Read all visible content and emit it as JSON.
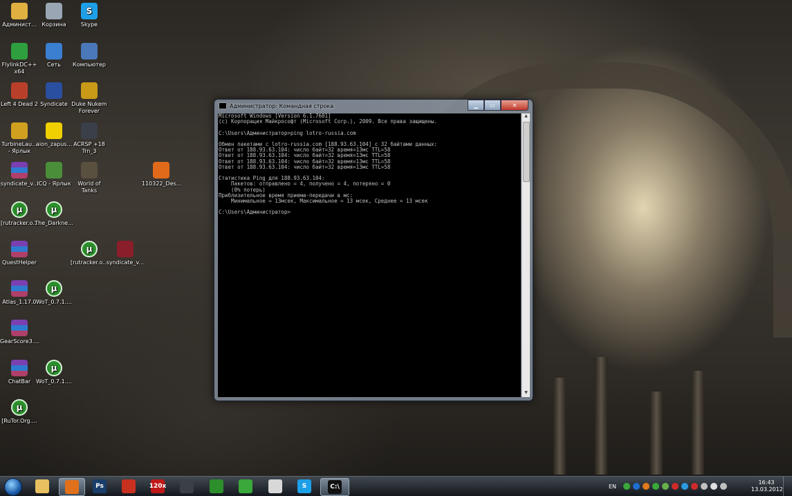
{
  "desktop_icons": [
    {
      "label": "Админист...",
      "icon": "user-folder-icon",
      "color": "#e0b040"
    },
    {
      "label": "Корзина",
      "icon": "recycle-bin-icon",
      "color": "#9aa6b4"
    },
    {
      "label": "Skype",
      "icon": "skype-icon",
      "color": "#1ea0e8"
    },
    {
      "label": "FlylinkDC++ x64",
      "icon": "flylink-icon",
      "color": "#2e9e3e"
    },
    {
      "label": "Сеть",
      "icon": "network-icon",
      "color": "#3a7fd0"
    },
    {
      "label": "Компьютер",
      "icon": "computer-icon",
      "color": "#4a78b8"
    },
    {
      "label": "Left 4 Dead 2",
      "icon": "game-icon",
      "color": "#b8402a"
    },
    {
      "label": "Syndicate",
      "icon": "game-icon",
      "color": "#2a4fa0"
    },
    {
      "label": "Duke Nukem Forever",
      "icon": "radiation-icon",
      "color": "#c89a18"
    },
    {
      "label": "TurbineLau... - Ярлык",
      "icon": "launcher-icon",
      "color": "#d0a020"
    },
    {
      "label": "aion_zapus...",
      "icon": "aion-icon",
      "color": "#f0d000"
    },
    {
      "label": "ACRSP +18 Trn_3",
      "icon": "star-icon",
      "color": "#3a3f4a"
    },
    {
      "label": "syndicate_v...",
      "icon": "winrar-icon",
      "color": "#7a3fb0"
    },
    {
      "label": "ICQ - Ярлык",
      "icon": "shortcut-icon",
      "color": "#4a8e3a"
    },
    {
      "label": "World of Tanks",
      "icon": "tank-icon",
      "color": "#5a5040"
    },
    {
      "label": "110322_Des...",
      "icon": "pdf-icon",
      "color": "#e06a1a"
    },
    {
      "label": "[rutracker.o...",
      "icon": "utorrent-icon",
      "color": "#2c8f2c"
    },
    {
      "label": "The_Darkne...",
      "icon": "utorrent-icon",
      "color": "#2c8f2c"
    },
    {
      "label": "QuestHelper",
      "icon": "winrar-icon",
      "color": "#7a3fb0"
    },
    {
      "label": "[rutracker.o...",
      "icon": "utorrent-icon",
      "color": "#2c8f2c"
    },
    {
      "label": "syndicate_v...",
      "icon": "daemon-icon",
      "color": "#8a1e2a"
    },
    {
      "label": "Atlas_1.17.0",
      "icon": "winrar-icon",
      "color": "#7a3fb0"
    },
    {
      "label": "WoT_0.7.1....",
      "icon": "utorrent-icon",
      "color": "#2c8f2c"
    },
    {
      "label": "GearScore3....",
      "icon": "winrar-icon",
      "color": "#7a3fb0"
    },
    {
      "label": "ChatBar",
      "icon": "winrar-icon",
      "color": "#7a3fb0"
    },
    {
      "label": "WoT_0.7.1....",
      "icon": "utorrent-icon",
      "color": "#2c8f2c"
    },
    {
      "label": "[RuTor.Org....",
      "icon": "utorrent-icon",
      "color": "#2c8f2c"
    }
  ],
  "cmd_window": {
    "title": "Администратор: Командная строка",
    "lines": [
      "Microsoft Windows [Version 6.1.7601]",
      "(c) Корпорация Майкрософт (Microsoft Corp.), 2009. Все права защищены.",
      "",
      "C:\\Users\\Администратор>ping lotro-russia.com",
      "",
      "Обмен пакетами с lotro-russia.com [188.93.63.104] с 32 байтами данных:",
      "Ответ от 188.93.63.104: число байт=32 время=13мс TTL=58",
      "Ответ от 188.93.63.104: число байт=32 время=13мс TTL=58",
      "Ответ от 188.93.63.104: число байт=32 время=13мс TTL=58",
      "Ответ от 188.93.63.104: число байт=32 время=13мс TTL=58",
      "",
      "Статистика Ping для 188.93.63.104:",
      "    Пакетов: отправлено = 4, получено = 4, потеряно = 0",
      "    (0% потерь)",
      "Приблизительное время приема-передачи в мс:",
      "    Минимальное = 13мсек, Максимальное = 13 мсек, Среднее = 13 мсек",
      "",
      "C:\\Users\\Администратор>"
    ]
  },
  "taskbar": {
    "pinned": [
      {
        "name": "explorer",
        "icon": "folder-icon",
        "glyph": "",
        "color": "#e8c060",
        "active": false
      },
      {
        "name": "firefox",
        "icon": "firefox-icon",
        "glyph": "",
        "color": "#e0701a",
        "active": true
      },
      {
        "name": "photoshop",
        "icon": "photoshop-icon",
        "glyph": "Ps",
        "color": "#1a3e6a",
        "active": false
      },
      {
        "name": "opera",
        "icon": "browser-icon",
        "glyph": "",
        "color": "#c83020",
        "active": false
      },
      {
        "name": "120x",
        "icon": "app-120x-icon",
        "glyph": "120x",
        "color": "#c01818",
        "active": false
      },
      {
        "name": "steam",
        "icon": "steam-icon",
        "glyph": "",
        "color": "#3a3f48",
        "active": false
      },
      {
        "name": "utorrent",
        "icon": "utorrent-icon",
        "glyph": "",
        "color": "#2c8f2c",
        "active": false
      },
      {
        "name": "icq",
        "icon": "icq-icon",
        "glyph": "",
        "color": "#3aa83a",
        "active": false
      },
      {
        "name": "notepad",
        "icon": "notepad-icon",
        "glyph": "",
        "color": "#d8d8d8",
        "active": false
      },
      {
        "name": "skype",
        "icon": "skype-icon",
        "glyph": "S",
        "color": "#1ea0e8",
        "active": false
      },
      {
        "name": "cmd",
        "icon": "cmd-icon",
        "glyph": "C:\\",
        "color": "#111111",
        "active": true
      }
    ],
    "language": "EN",
    "clock_time": "16:43",
    "clock_date": "13.03.2012",
    "tray_colors": [
      "#3aa83a",
      "#1e6fd0",
      "#e07a1a",
      "#3aa83a",
      "#6ab04a",
      "#d02a2a",
      "#2a9ae0",
      "#d02a2a",
      "#c0c0c0",
      "#e0e0e0",
      "#c0c0c0"
    ]
  }
}
